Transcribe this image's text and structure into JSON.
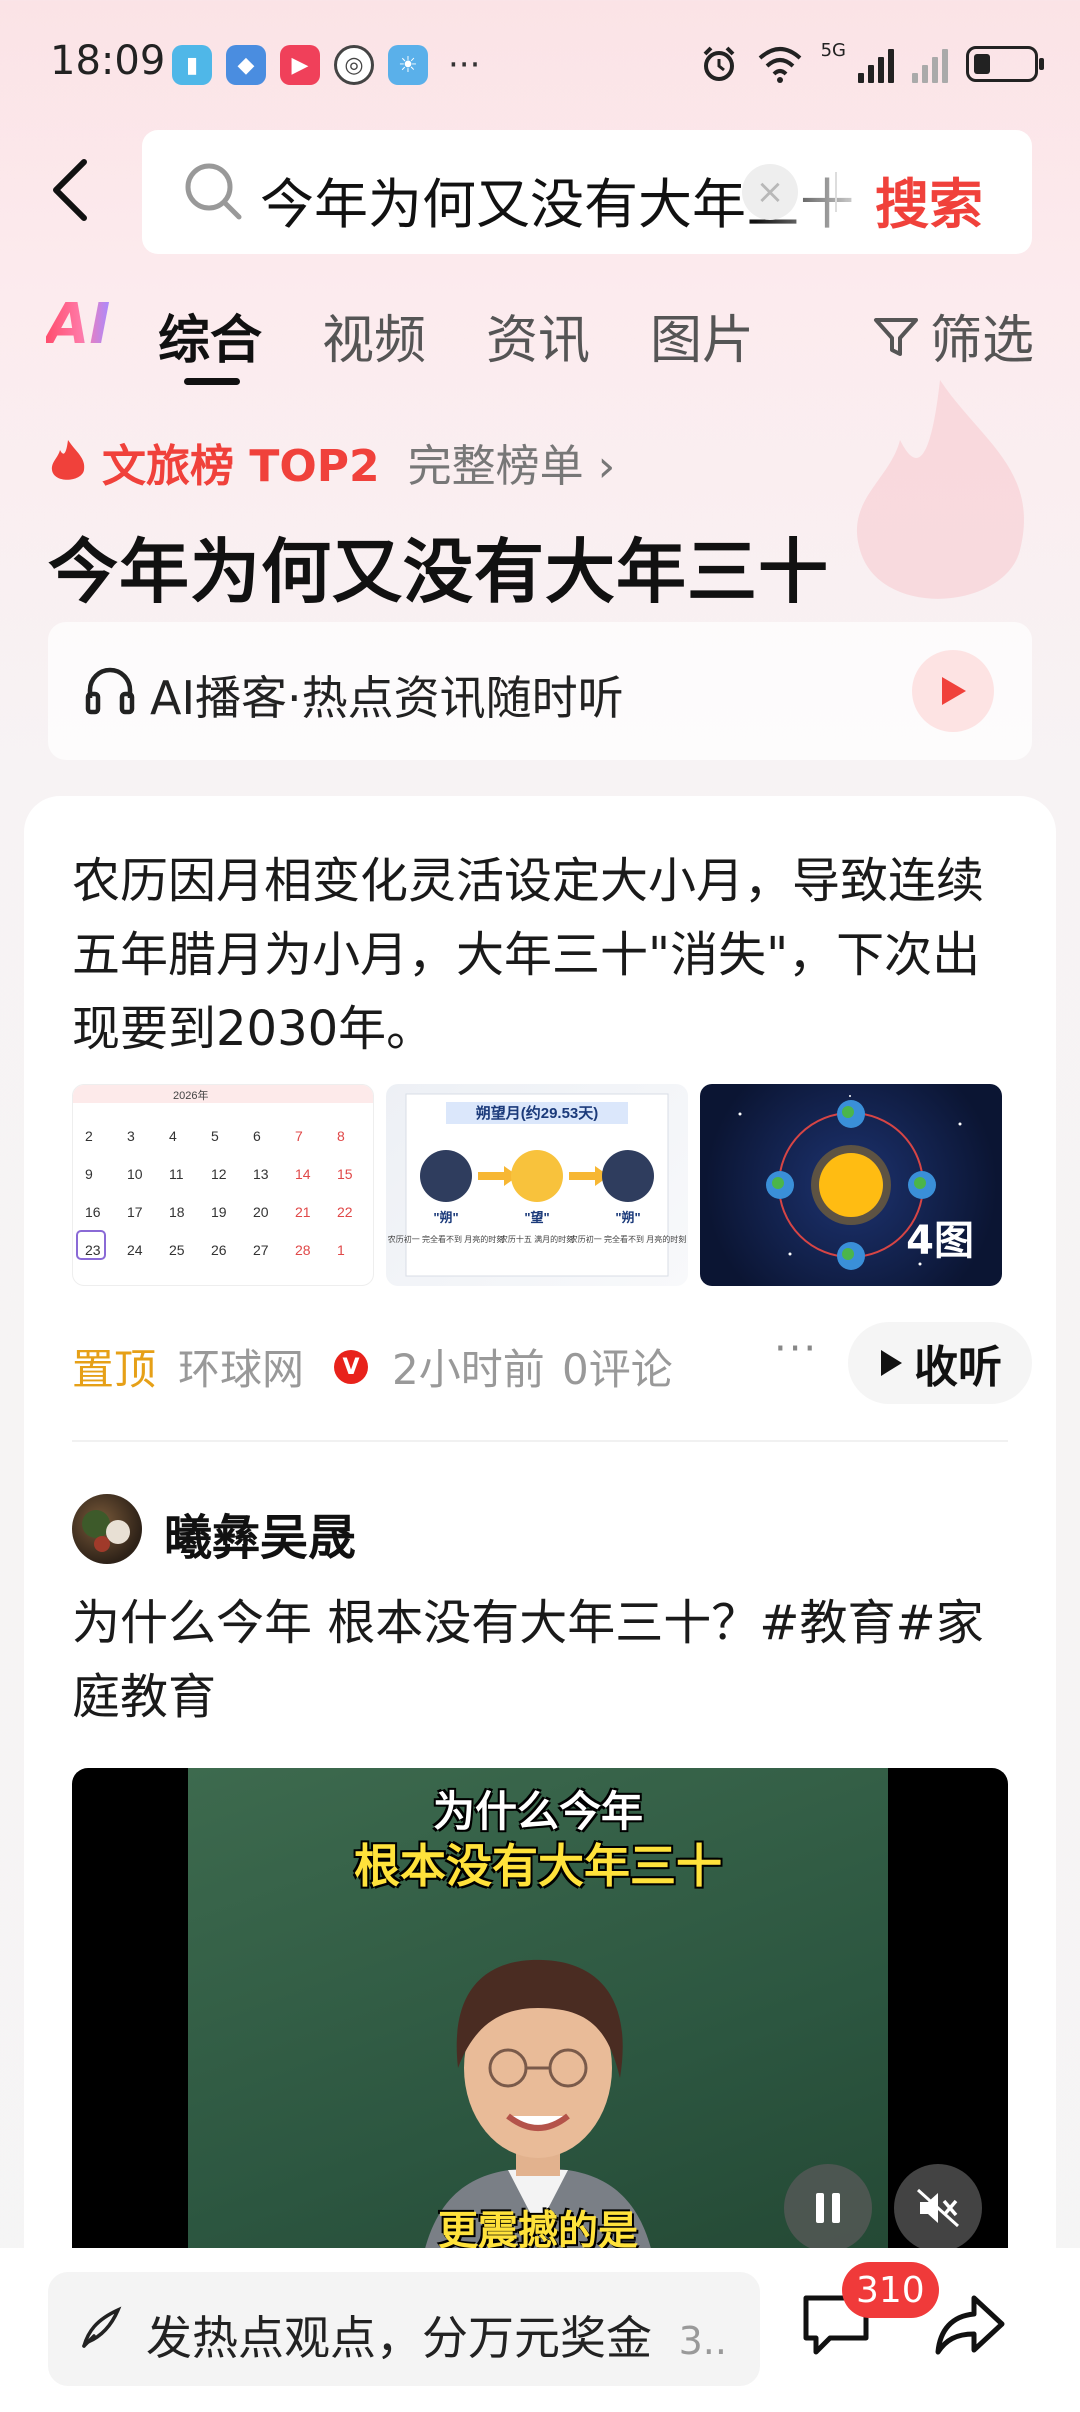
{
  "status": {
    "time": "18:09",
    "more": "···",
    "network_label": "5G"
  },
  "search": {
    "query": "今年为何又没有大年三十",
    "button": "搜索"
  },
  "tabs": {
    "ai": "AI",
    "items": [
      "综合",
      "视频",
      "资讯",
      "图片"
    ],
    "active": "综合",
    "filter": "筛选"
  },
  "hot": {
    "rank_label": "文旅榜 TOP2",
    "full_list": "完整榜单 ›",
    "title": "今年为何又没有大年三十",
    "podcast": "AI播客·热点资讯随时听"
  },
  "card1": {
    "summary": "农历因月相变化灵活设定大小月，导致连续五年腊月为小月，大年三十\"消失\"，下次出现要到2030年。",
    "image_count": "4图",
    "thumb2": {
      "heading": "朔望月(约29.53天)",
      "labels": [
        "\"朔\"",
        "\"望\"",
        "\"朔\""
      ],
      "notes": [
        "农历初一 完全看不到 月亮的时刻",
        "农历十五 满月的时刻",
        "农历初一 完全看不到 月亮的时刻"
      ]
    },
    "calendar": {
      "year": "2026年",
      "days": [
        "2",
        "3",
        "4",
        "5",
        "6",
        "7",
        "8",
        "9",
        "10",
        "11",
        "12",
        "13",
        "14",
        "15",
        "16",
        "17",
        "18",
        "19",
        "20",
        "21",
        "22",
        "23",
        "24",
        "25",
        "26",
        "27",
        "28",
        "1"
      ]
    },
    "pin": "置顶",
    "source": "环球网",
    "verified": "V",
    "time_ago": "2小时前",
    "comments": "0评论",
    "more": "···",
    "listen": "收听"
  },
  "card2": {
    "author": "曦彝吴晟",
    "title": "为什么今年 根本没有大年三十？#教育#家庭教育",
    "video_caption_1": "为什么今年",
    "video_caption_2": "根本没有大年三十",
    "video_caption_3": "更震撼的是"
  },
  "bottom": {
    "input_text": "发热点观点，分万元奖金",
    "input_count": "3..",
    "comment_badge": "310"
  },
  "colors": {
    "accent": "#f0413b",
    "pin": "#e6a017"
  }
}
